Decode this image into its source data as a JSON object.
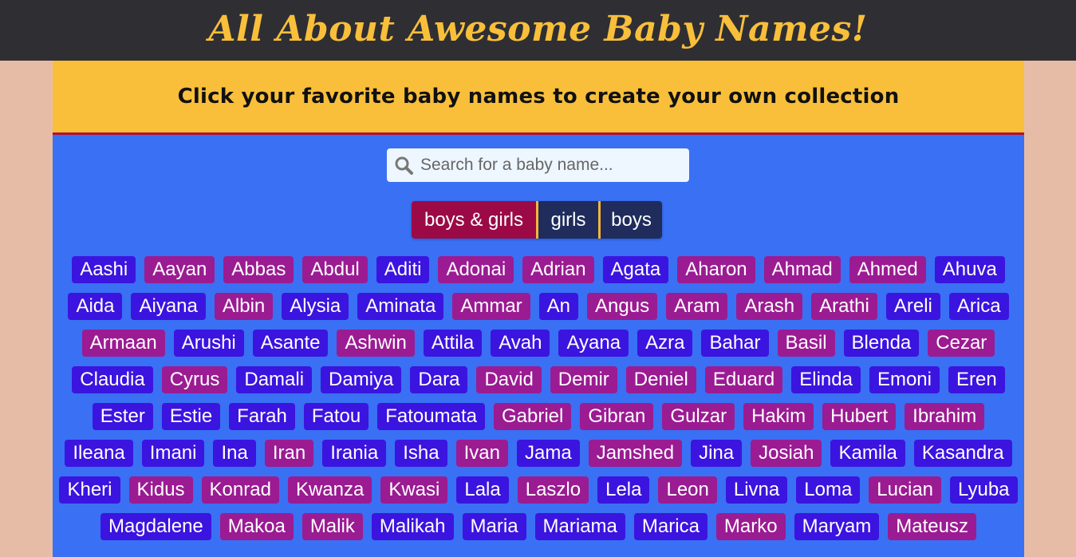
{
  "header": {
    "title": "All About Awesome Baby Names!"
  },
  "banner": {
    "text": "Click your favorite baby names to create your own collection"
  },
  "search": {
    "placeholder": "Search for a baby name...",
    "icon": "search-icon"
  },
  "filters": [
    {
      "label": "boys & girls",
      "active": true
    },
    {
      "label": "girls",
      "active": false
    },
    {
      "label": "boys",
      "active": false
    }
  ],
  "colors": {
    "page_bg": "#e7bca6",
    "header_bg": "#2f2f33",
    "title": "#f9bf3b",
    "banner_bg": "#f9bf3b",
    "banner_border": "#b3122d",
    "main_bg": "#3a70f3",
    "girl_chip": "#9b1b93",
    "boy_chip": "#3b14df",
    "active_tab": "#9b0a46",
    "inactive_tab": "#1f2c5c",
    "tab_divider": "#f3b63a"
  },
  "names_rows": [
    [
      {
        "name": "Aashi",
        "type": "boy"
      },
      {
        "name": "Aayan",
        "type": "girl"
      },
      {
        "name": "Abbas",
        "type": "girl"
      },
      {
        "name": "Abdul",
        "type": "girl"
      },
      {
        "name": "Aditi",
        "type": "boy"
      },
      {
        "name": "Adonai",
        "type": "girl"
      },
      {
        "name": "Adrian",
        "type": "girl"
      },
      {
        "name": "Agata",
        "type": "boy"
      },
      {
        "name": "Aharon",
        "type": "girl"
      },
      {
        "name": "Ahmad",
        "type": "girl"
      },
      {
        "name": "Ahmed",
        "type": "girl"
      },
      {
        "name": "Ahuva",
        "type": "boy"
      }
    ],
    [
      {
        "name": "Aida",
        "type": "boy"
      },
      {
        "name": "Aiyana",
        "type": "boy"
      },
      {
        "name": "Albin",
        "type": "girl"
      },
      {
        "name": "Alysia",
        "type": "boy"
      },
      {
        "name": "Aminata",
        "type": "boy"
      },
      {
        "name": "Ammar",
        "type": "girl"
      },
      {
        "name": "An",
        "type": "boy"
      },
      {
        "name": "Angus",
        "type": "girl"
      },
      {
        "name": "Aram",
        "type": "girl"
      },
      {
        "name": "Arash",
        "type": "girl"
      },
      {
        "name": "Arathi",
        "type": "girl"
      },
      {
        "name": "Areli",
        "type": "boy"
      },
      {
        "name": "Arica",
        "type": "boy"
      }
    ],
    [
      {
        "name": "Armaan",
        "type": "girl"
      },
      {
        "name": "Arushi",
        "type": "boy"
      },
      {
        "name": "Asante",
        "type": "boy"
      },
      {
        "name": "Ashwin",
        "type": "girl"
      },
      {
        "name": "Attila",
        "type": "boy"
      },
      {
        "name": "Avah",
        "type": "boy"
      },
      {
        "name": "Ayana",
        "type": "boy"
      },
      {
        "name": "Azra",
        "type": "boy"
      },
      {
        "name": "Bahar",
        "type": "boy"
      },
      {
        "name": "Basil",
        "type": "girl"
      },
      {
        "name": "Blenda",
        "type": "boy"
      },
      {
        "name": "Cezar",
        "type": "girl"
      }
    ],
    [
      {
        "name": "Claudia",
        "type": "boy"
      },
      {
        "name": "Cyrus",
        "type": "girl"
      },
      {
        "name": "Damali",
        "type": "boy"
      },
      {
        "name": "Damiya",
        "type": "boy"
      },
      {
        "name": "Dara",
        "type": "boy"
      },
      {
        "name": "David",
        "type": "girl"
      },
      {
        "name": "Demir",
        "type": "girl"
      },
      {
        "name": "Deniel",
        "type": "girl"
      },
      {
        "name": "Eduard",
        "type": "girl"
      },
      {
        "name": "Elinda",
        "type": "boy"
      },
      {
        "name": "Emoni",
        "type": "boy"
      },
      {
        "name": "Eren",
        "type": "boy"
      }
    ],
    [
      {
        "name": "Ester",
        "type": "boy"
      },
      {
        "name": "Estie",
        "type": "boy"
      },
      {
        "name": "Farah",
        "type": "boy"
      },
      {
        "name": "Fatou",
        "type": "boy"
      },
      {
        "name": "Fatoumata",
        "type": "boy"
      },
      {
        "name": "Gabriel",
        "type": "girl"
      },
      {
        "name": "Gibran",
        "type": "girl"
      },
      {
        "name": "Gulzar",
        "type": "girl"
      },
      {
        "name": "Hakim",
        "type": "girl"
      },
      {
        "name": "Hubert",
        "type": "girl"
      },
      {
        "name": "Ibrahim",
        "type": "girl"
      }
    ],
    [
      {
        "name": "Ileana",
        "type": "boy"
      },
      {
        "name": "Imani",
        "type": "boy"
      },
      {
        "name": "Ina",
        "type": "boy"
      },
      {
        "name": "Iran",
        "type": "girl"
      },
      {
        "name": "Irania",
        "type": "boy"
      },
      {
        "name": "Isha",
        "type": "boy"
      },
      {
        "name": "Ivan",
        "type": "girl"
      },
      {
        "name": "Jama",
        "type": "boy"
      },
      {
        "name": "Jamshed",
        "type": "girl"
      },
      {
        "name": "Jina",
        "type": "boy"
      },
      {
        "name": "Josiah",
        "type": "girl"
      },
      {
        "name": "Kamila",
        "type": "boy"
      },
      {
        "name": "Kasandra",
        "type": "boy"
      }
    ],
    [
      {
        "name": "Kheri",
        "type": "boy"
      },
      {
        "name": "Kidus",
        "type": "girl"
      },
      {
        "name": "Konrad",
        "type": "girl"
      },
      {
        "name": "Kwanza",
        "type": "girl"
      },
      {
        "name": "Kwasi",
        "type": "girl"
      },
      {
        "name": "Lala",
        "type": "boy"
      },
      {
        "name": "Laszlo",
        "type": "girl"
      },
      {
        "name": "Lela",
        "type": "boy"
      },
      {
        "name": "Leon",
        "type": "girl"
      },
      {
        "name": "Livna",
        "type": "boy"
      },
      {
        "name": "Loma",
        "type": "boy"
      },
      {
        "name": "Lucian",
        "type": "girl"
      },
      {
        "name": "Lyuba",
        "type": "boy"
      }
    ],
    [
      {
        "name": "Magdalene",
        "type": "boy"
      },
      {
        "name": "Makoa",
        "type": "girl"
      },
      {
        "name": "Malik",
        "type": "girl"
      },
      {
        "name": "Malikah",
        "type": "boy"
      },
      {
        "name": "Maria",
        "type": "boy"
      },
      {
        "name": "Mariama",
        "type": "boy"
      },
      {
        "name": "Marica",
        "type": "boy"
      },
      {
        "name": "Marko",
        "type": "girl"
      },
      {
        "name": "Maryam",
        "type": "boy"
      },
      {
        "name": "Mateusz",
        "type": "girl"
      }
    ]
  ]
}
